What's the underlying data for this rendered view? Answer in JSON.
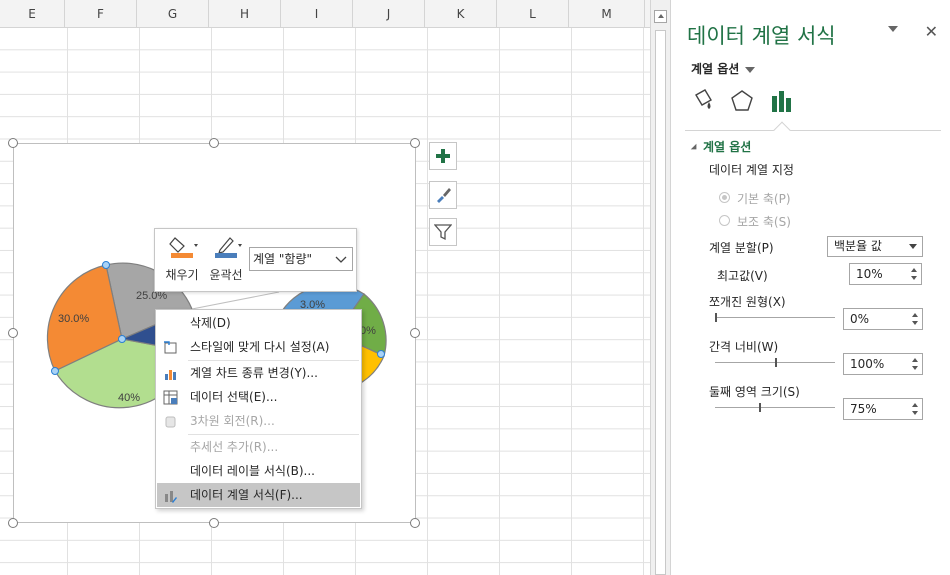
{
  "sheet": {
    "columns": [
      "E",
      "F",
      "G",
      "H",
      "I",
      "J",
      "K",
      "L",
      "M"
    ]
  },
  "chart": {
    "slice_labels": [
      "25.0%",
      "30.0%",
      "40%",
      "3.0%",
      "0%"
    ],
    "colors": {
      "gray": "#a6a6a6",
      "orange": "#f48a34",
      "green": "#b2de8f",
      "navy": "#2f4f8f",
      "blue": "#5b9bd5",
      "dgreen": "#70ad47",
      "yellow": "#ffc000"
    },
    "side_buttons": [
      "plus-icon",
      "brush-icon",
      "filter-icon"
    ]
  },
  "mini_toolbar": {
    "fill_label": "채우기",
    "outline_label": "윤곽선",
    "series_select": "계열 \"함량\""
  },
  "context_menu": {
    "items": [
      {
        "label": "삭제(D)",
        "icon": "delete-icon"
      },
      {
        "label": "스타일에 맞게 다시 설정(A)",
        "icon": "reset-style-icon"
      },
      {
        "label": "계열 차트 종류 변경(Y)...",
        "icon": "chart-type-icon"
      },
      {
        "label": "데이터 선택(E)...",
        "icon": "select-data-icon"
      },
      {
        "label": "3차원 회전(R)...",
        "icon": "rotate-3d-icon"
      },
      {
        "label": "추세선 추가(R)...",
        "icon": ""
      },
      {
        "label": "데이터 레이블 서식(B)...",
        "icon": ""
      },
      {
        "label": "데이터 계열 서식(F)...",
        "icon": "format-series-icon"
      }
    ]
  },
  "pane": {
    "title": "데이터 계열 서식",
    "subtitle": "계열 옵션",
    "section": "계열 옵션",
    "plot_series_on": "데이터 계열 지정",
    "primary_axis": "기본 축(P)",
    "secondary_axis": "보조 축(S)",
    "split_series_by": "계열 분할(P)",
    "split_value": "백분율 값",
    "max_value_label": "최고값(V)",
    "max_value": "10%",
    "explosion_label": "쪼개진 원형(X)",
    "explosion_value": "0%",
    "gap_width_label": "간격 너비(W)",
    "gap_width_value": "100%",
    "second_plot_size_label": "둘째 영역 크기(S)",
    "second_plot_size_value": "75%",
    "accent_color": "#217346"
  }
}
